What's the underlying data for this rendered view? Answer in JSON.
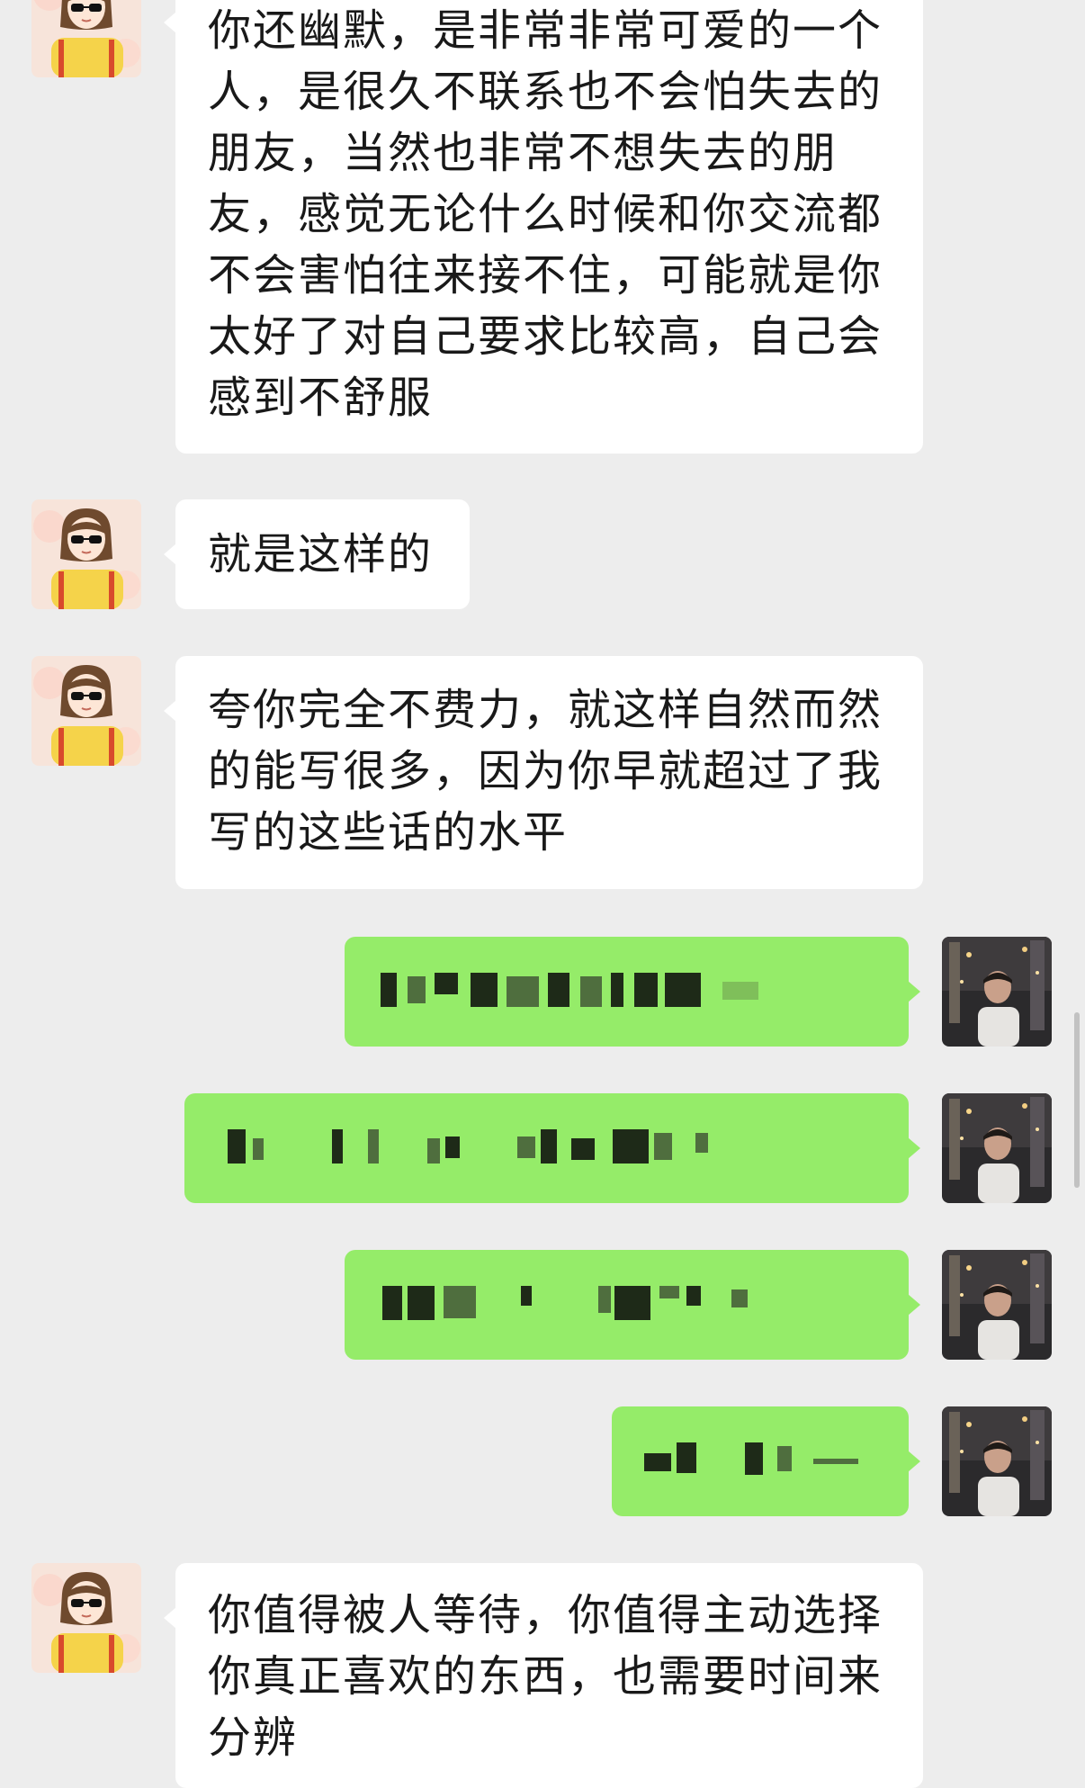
{
  "messages": [
    {
      "side": "left",
      "sender": "female-avatar",
      "text": "你还幽默，是非常非常可爱的一个人，是很久不联系也不会怕失去的朋友，当然也非常不想失去的朋友，感觉无论什么时候和你交流都不会害怕往来接不住，可能就是你太好了对自己要求比较高，自己会感到不舒服"
    },
    {
      "side": "left",
      "sender": "female-avatar",
      "text": "就是这样的"
    },
    {
      "side": "left",
      "sender": "female-avatar",
      "text": "夸你完全不费力，就这样自然而然的能写很多，因为你早就超过了我写的这些话的水平"
    },
    {
      "side": "right",
      "sender": "male-avatar",
      "text": "",
      "content": "pixelated"
    },
    {
      "side": "right",
      "sender": "male-avatar",
      "text": "",
      "content": "pixelated"
    },
    {
      "side": "right",
      "sender": "male-avatar",
      "text": "",
      "content": "pixelated"
    },
    {
      "side": "right",
      "sender": "male-avatar",
      "text": "",
      "content": "pixelated"
    },
    {
      "side": "left",
      "sender": "female-avatar",
      "text": "你值得被人等待，你值得主动选择你真正喜欢的东西，也需要时间来分辨"
    }
  ],
  "colors": {
    "background": "#ededed",
    "incoming_bubble": "#ffffff",
    "outgoing_bubble": "#95ec69",
    "text": "#191919"
  }
}
